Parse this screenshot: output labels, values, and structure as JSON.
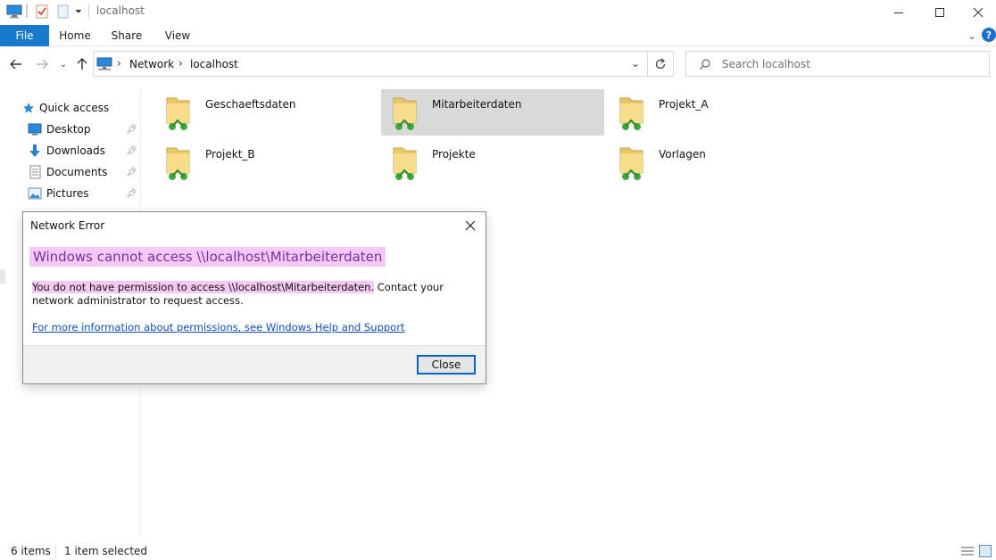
{
  "window": {
    "title": "localhost"
  },
  "ribbon": {
    "tabs": [
      "File",
      "Home",
      "Share",
      "View"
    ]
  },
  "address": {
    "crumbs": [
      "Network",
      "localhost"
    ],
    "search_placeholder": "Search localhost"
  },
  "sidebar": {
    "items": [
      {
        "label": "Quick access",
        "icon": "star-icon"
      },
      {
        "label": "Desktop",
        "icon": "desktop-icon"
      },
      {
        "label": "Downloads",
        "icon": "download-icon"
      },
      {
        "label": "Documents",
        "icon": "document-icon"
      },
      {
        "label": "Pictures",
        "icon": "pictures-icon"
      }
    ]
  },
  "content": {
    "items": [
      {
        "name": "Geschaeftsdaten",
        "selected": false
      },
      {
        "name": "Mitarbeiterdaten",
        "selected": true
      },
      {
        "name": "Projekt_A",
        "selected": false
      },
      {
        "name": "Projekt_B",
        "selected": false
      },
      {
        "name": "Projekte",
        "selected": false
      },
      {
        "name": "Vorlagen",
        "selected": false
      }
    ]
  },
  "status": {
    "count": "6 items",
    "selected": "1 item selected"
  },
  "dialog": {
    "title": "Network Error",
    "heading": "Windows cannot access \\\\localhost\\Mitarbeiterdaten",
    "message_highlight": "You do not have permission to access \\\\localhost\\Mitarbeiterdaten.",
    "message_rest": " Contact your network administrator to request access.",
    "link": "For more information about permissions, see Windows Help and Support",
    "close_label": "Close"
  },
  "colors": {
    "accent": "#1979ca",
    "highlight": "#f6c8f6",
    "heading_text": "#7a2f9c",
    "link": "#0f4fb5",
    "selection": "#d9d9d9"
  }
}
